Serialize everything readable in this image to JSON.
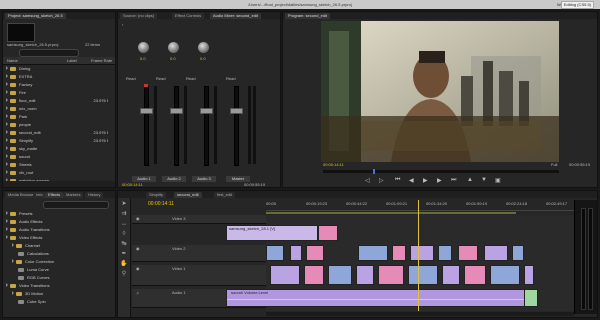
{
  "titlebar": {
    "path": "/Users/.../final_project/dailies/samsung_sketch_26.5.prproj",
    "workspace_label": "Workspace:",
    "workspace_value": "Editing (CS5.5)"
  },
  "project": {
    "tab_label": "Project: samsung_sketch_26.5",
    "file_name": "samsung_sketch_26.5.prproj",
    "item_count": "22 items",
    "col_name": "Name",
    "col_label": "Label",
    "col_frame": "Frame Rate",
    "items": [
      {
        "name": "Dining",
        "rate": ""
      },
      {
        "name": "EXTRA",
        "rate": ""
      },
      {
        "name": "Factory",
        "rate": ""
      },
      {
        "name": "Fire",
        "rate": ""
      },
      {
        "name": "floor_edit",
        "rate": "23.976 f"
      },
      {
        "name": "mix_room",
        "rate": ""
      },
      {
        "name": "Park",
        "rate": ""
      },
      {
        "name": "people",
        "rate": ""
      },
      {
        "name": "second_edit",
        "rate": "23.976 f"
      },
      {
        "name": "Simplify",
        "rate": "23.976 f"
      },
      {
        "name": "sky_matte",
        "rate": ""
      },
      {
        "name": "sound",
        "rate": ""
      },
      {
        "name": "Streets",
        "rate": ""
      },
      {
        "name": "vfx_roof",
        "rate": ""
      },
      {
        "name": "watching-women",
        "rate": ""
      }
    ]
  },
  "mixer": {
    "tabs": [
      "Source: (no clips)",
      "Effect Controls",
      "Audio Mixer: second_edit"
    ],
    "read_label": "Read",
    "knob_values": [
      "0.0",
      "0.0",
      "0.0"
    ],
    "channels": [
      "Audio 1",
      "Audio 2",
      "Audio 3",
      "Master"
    ],
    "timecode_left": "00:00:14:11",
    "timecode_right": "00:00:55:19"
  },
  "program": {
    "tab_label": "Program: second_edit",
    "timecode": "00:00:14:11",
    "fit_label": "Full",
    "duration": "00:00:55:19"
  },
  "effects": {
    "tabs": [
      "Media Browser",
      "Info",
      "Effects",
      "Markers",
      "History"
    ],
    "tree": [
      {
        "label": "Presets",
        "indent": 0
      },
      {
        "label": "Audio Effects",
        "indent": 0
      },
      {
        "label": "Audio Transitions",
        "indent": 0
      },
      {
        "label": "Video Effects",
        "indent": 0
      },
      {
        "label": "Channel",
        "indent": 1
      },
      {
        "label": "Calculations",
        "indent": 2
      },
      {
        "label": "Color Correction",
        "indent": 1
      },
      {
        "label": "Luma Curve",
        "indent": 2
      },
      {
        "label": "RGB Curves",
        "indent": 2
      },
      {
        "label": "Video Transitions",
        "indent": 0
      },
      {
        "label": "3D Motion",
        "indent": 1
      },
      {
        "label": "Cube Spin",
        "indent": 2
      }
    ]
  },
  "timeline": {
    "tabs": [
      "Simplify",
      "second_edit",
      "first_edit"
    ],
    "timecode": "00:00:14:11",
    "ruler": [
      "00:00",
      "00:00:19:23",
      "00:00:44:22",
      "00:01:09:21",
      "00:01:34:20",
      "00:01:59:19",
      "00:02:24:18",
      "00:02:49:17"
    ],
    "video_tracks": [
      "Video 3",
      "Video 2",
      "Video 1"
    ],
    "audio_tracks": [
      "Audio 1"
    ],
    "clip_label_v1": "samsung_sketch_28.1 [V]",
    "clip_label_a1": "sound/ Volume:Level"
  },
  "colors": {
    "accent": "#e8c500",
    "clip_pink": "#e68ab8",
    "clip_blue": "#8fa6d8",
    "clip_violet": "#b9a3e3",
    "audio_clip": "#b197e0",
    "selection": "#f0c020"
  }
}
